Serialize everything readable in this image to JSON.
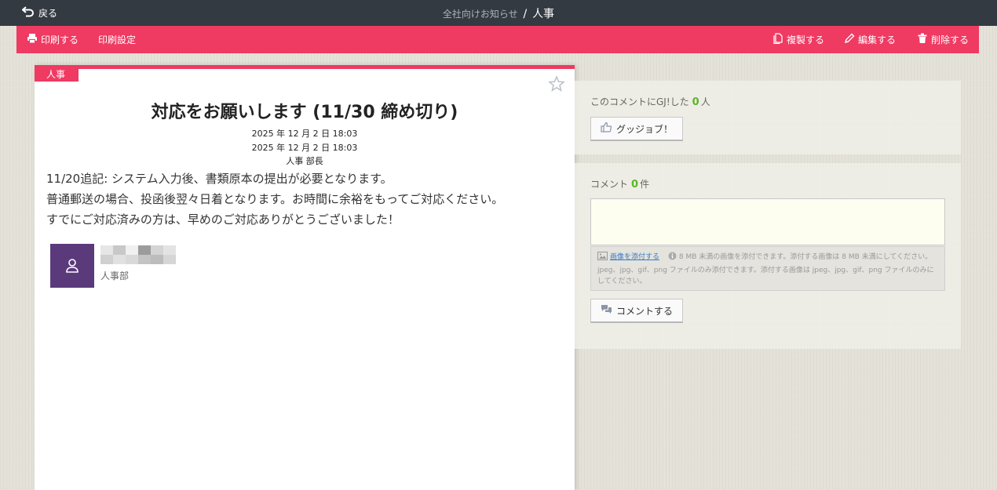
{
  "topbar": {
    "back_label": "戻る",
    "breadcrumb_parent": "全社向けお知らせ",
    "breadcrumb_sep": "/",
    "breadcrumb_current": "人事"
  },
  "actions": {
    "print": "印刷する",
    "print_settings": "印刷設定",
    "duplicate": "複製する",
    "edit": "編集する",
    "delete": "削除する"
  },
  "article": {
    "category_tag": "人事",
    "title": "対応をお願いします (11/30 締め切り)",
    "created": "2025 年 12 月 2 日 18:03",
    "updated": "2025 年 12 月 2 日 18:03",
    "sender": "人事 部長",
    "body": [
      "11/20追記: システム入力後、書類原本の提出が必要となります。",
      "普通郵送の場合、投函後翌々日着となります。お時間に余裕をもってご対応ください。",
      "すでにご対応済みの方は、早めのご対応ありがとうございました！"
    ],
    "author_department": "人事部"
  },
  "gj": {
    "label_prefix": "このコメントにGJ!した",
    "count": "0",
    "label_suffix": "人",
    "button_label": "グッジョブ！"
  },
  "comments": {
    "label_prefix": "コメント",
    "count": "0",
    "label_suffix": "件",
    "textarea_value": "",
    "attach_link": "画像を添付する",
    "attach_note": "8 MB 未満の画像を添付できます。添付する画像は 8 MB 未満にしてください。jpeg、jpg、gif、png ファイルのみ添付できます。添付する画像は jpeg、jpg、gif、png ファイルのみにしてください。",
    "submit_label": "コメントする"
  },
  "colors": {
    "accent": "#ef3a62",
    "topbar": "#343a41",
    "avatar": "#5b3a7c",
    "count_green": "#5ab52a"
  }
}
